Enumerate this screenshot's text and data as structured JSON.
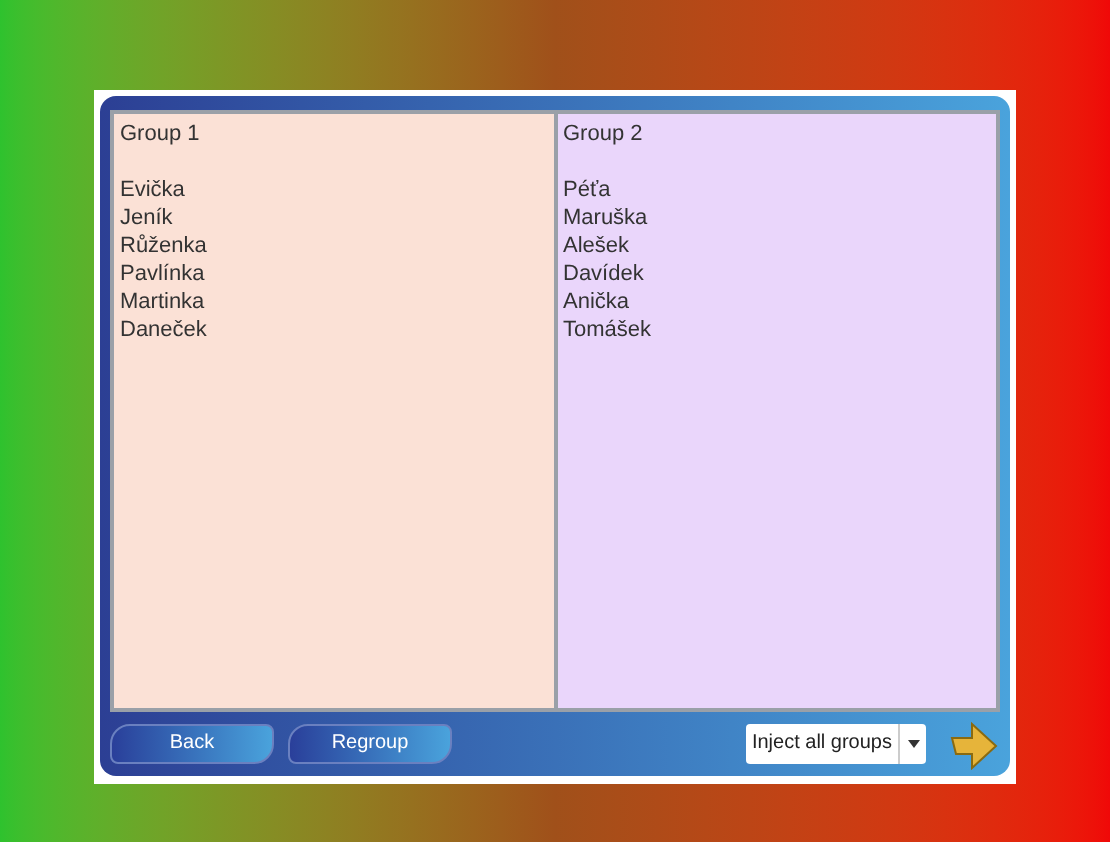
{
  "groups": [
    {
      "title": "Group 1",
      "members": [
        "Evička",
        "Jeník",
        "Růženka",
        "Pavlínka",
        "Martinka",
        "Daneček"
      ]
    },
    {
      "title": "Group 2",
      "members": [
        "Péťa",
        "Maruška",
        "Alešek",
        "Davídek",
        "Anička",
        "Tomášek"
      ]
    }
  ],
  "buttons": [
    "Back",
    "Regroup"
  ],
  "dropdown": {
    "value": "Inject all groups"
  }
}
